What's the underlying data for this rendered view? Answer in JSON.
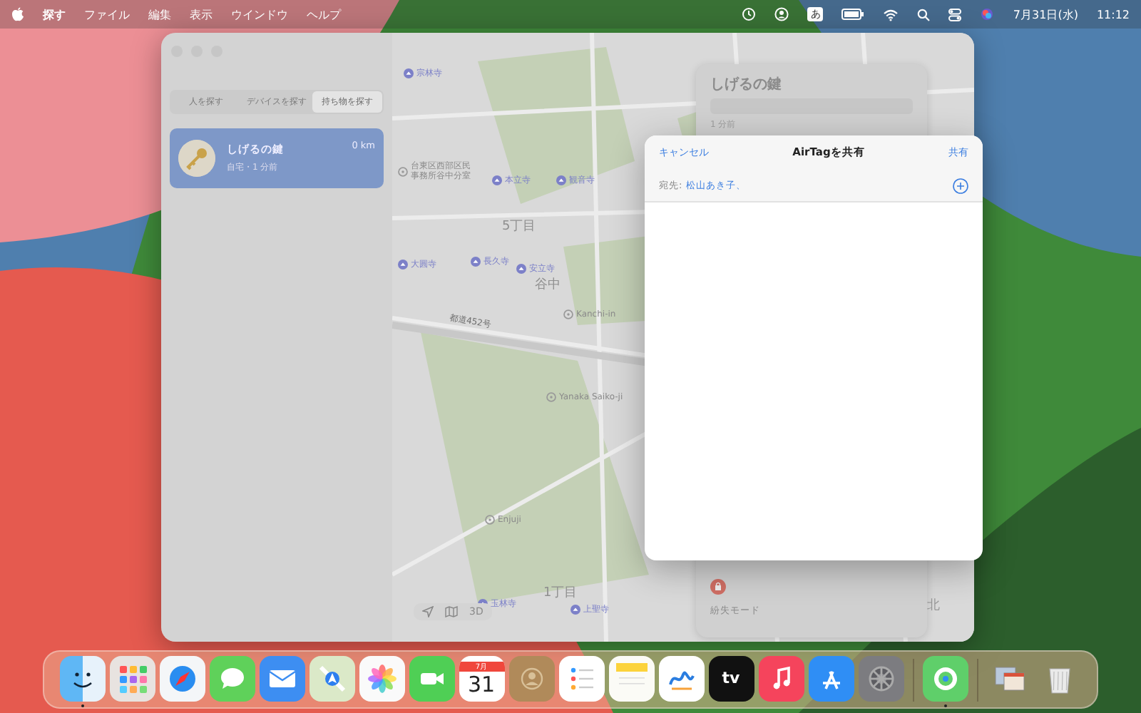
{
  "menu_bar": {
    "items": [
      {
        "label": "探す",
        "kind": "app"
      },
      {
        "label": "ファイル",
        "kind": "menu"
      },
      {
        "label": "編集",
        "kind": "menu"
      },
      {
        "label": "表示",
        "kind": "menu"
      },
      {
        "label": "ウインドウ",
        "kind": "menu"
      },
      {
        "label": "ヘルプ",
        "kind": "menu"
      }
    ],
    "input_method": "あ",
    "date": "7月31日(水)",
    "time": "11:12"
  },
  "sidebar": {
    "tabs": [
      {
        "label": "人を探す",
        "selected": false
      },
      {
        "label": "デバイスを探す",
        "selected": false
      },
      {
        "label": "持ち物を探す",
        "selected": true
      }
    ],
    "items": [
      {
        "name": "しげるの鍵",
        "detail": "自宅・1 分前",
        "distance": "0 km",
        "selected": true
      }
    ]
  },
  "map": {
    "labels": [
      {
        "text": "宗林寺",
        "kind": "temple"
      },
      {
        "text": "台東区西部区民事務所谷中分室",
        "kind": "place"
      },
      {
        "text": "本立寺",
        "kind": "temple"
      },
      {
        "text": "観音寺",
        "kind": "temple"
      },
      {
        "text": "5丁目",
        "kind": "area"
      },
      {
        "text": "大圓寺",
        "kind": "temple"
      },
      {
        "text": "長久寺",
        "kind": "temple"
      },
      {
        "text": "安立寺",
        "kind": "temple"
      },
      {
        "text": "谷中",
        "kind": "area"
      },
      {
        "text": "Kanchi-in",
        "kind": "place"
      },
      {
        "text": "都道452号",
        "kind": "road"
      },
      {
        "text": "Yanaka Saiko-ji",
        "kind": "place"
      },
      {
        "text": "Enjuji",
        "kind": "place"
      },
      {
        "text": "1丁目",
        "kind": "area"
      },
      {
        "text": "玉林寺",
        "kind": "temple"
      },
      {
        "text": "上聖寺",
        "kind": "temple"
      }
    ],
    "view_3d": "3D",
    "compass": "北"
  },
  "info_panel": {
    "title": "しげるの鍵",
    "updated": "1 分前",
    "lost_mode": "紛失モード"
  },
  "sheet": {
    "cancel": "キャンセル",
    "title": "AirTagを共有",
    "share": "共有",
    "to_label": "宛先:",
    "recipient": "松山あき子、"
  },
  "dock": [
    {
      "kind": "finder",
      "running": true
    },
    {
      "kind": "launchpad",
      "running": false
    },
    {
      "kind": "safari",
      "running": false
    },
    {
      "kind": "messages",
      "running": false
    },
    {
      "kind": "mail",
      "running": false
    },
    {
      "kind": "maps",
      "running": false
    },
    {
      "kind": "photos",
      "running": false
    },
    {
      "kind": "facetime",
      "running": false
    },
    {
      "kind": "calendar",
      "running": false,
      "month": "7月",
      "day": "31"
    },
    {
      "kind": "contacts",
      "running": false
    },
    {
      "kind": "reminders",
      "running": false
    },
    {
      "kind": "notes",
      "running": false
    },
    {
      "kind": "freeform",
      "running": false
    },
    {
      "kind": "tv",
      "running": false,
      "text": "tv"
    },
    {
      "kind": "music",
      "running": false
    },
    {
      "kind": "appstore",
      "running": false
    },
    {
      "kind": "settings",
      "running": false
    },
    {
      "kind": "separator"
    },
    {
      "kind": "findmy",
      "running": true
    },
    {
      "kind": "separator"
    },
    {
      "kind": "windows",
      "running": false
    },
    {
      "kind": "trash",
      "running": false
    }
  ]
}
